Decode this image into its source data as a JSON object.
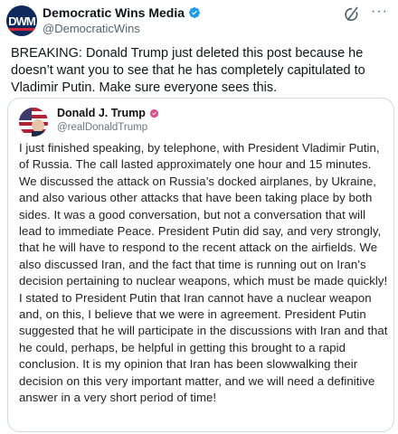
{
  "header": {
    "display_name": "Democratic Wins Media",
    "handle": "@DemocraticWins",
    "avatar_initials": "DWM",
    "verified_icon": "verified-badge-icon",
    "grok_icon": "grok-icon",
    "more_icon": "more-icon",
    "more_glyph": "···"
  },
  "tweet": {
    "text": "BREAKING: Donald Trump just deleted this post because he doesn’t want you to see that he has completely capitulated to Vladimir Putin. Make sure everyone sees this."
  },
  "quoted_post": {
    "display_name": "Donald J. Trump",
    "handle": "@realDonaldTrump",
    "badge_icon": "verified-badge-icon",
    "text": "I just finished speaking, by telephone, with President Vladimir Putin, of Russia. The call lasted approximately one hour and 15 minutes. We discussed the attack on Russia’s docked airplanes, by Ukraine, and also various other attacks that have been taking place by both sides. It was a good conversation, but not a conversation that will lead to immediate Peace. President Putin did say, and very strongly, that he will have to respond to the recent attack on the airfields. We also discussed Iran, and the fact that time is running out on Iran’s decision pertaining to nuclear weapons, which must be made quickly! I stated to President Putin that Iran cannot have a nuclear weapon and, on this, I believe that we were in agreement. President Putin suggested that he will participate in the discussions with Iran and that he could, perhaps, be helpful in getting this brought to a rapid conclusion. It is my opinion that Iran has been slowwalking their decision on this very important matter, and we will need a definitive answer in a very short period of time!"
  },
  "colors": {
    "text_primary": "#0f1419",
    "text_secondary": "#536471",
    "verified_blue": "#1d9bf0",
    "card_border": "#cfd9de",
    "avatar_navy": "#0e2a5c",
    "avatar_red": "#d3223a"
  }
}
